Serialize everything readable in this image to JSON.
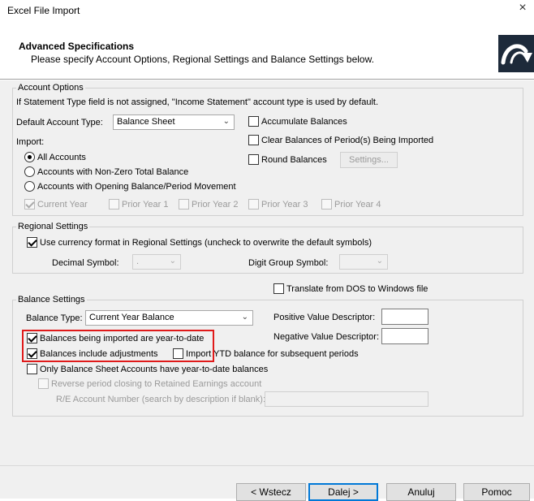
{
  "window": {
    "title": "Excel File Import",
    "close_glyph": "×"
  },
  "header": {
    "title": "Advanced Specifications",
    "subtitle": "Please specify Account Options, Regional Settings and Balance Settings below.",
    "logo_icon": "curved-arrow-logo-icon"
  },
  "account_options": {
    "legend": "Account Options",
    "note": "If Statement Type field is not assigned, \"Income Statement\" account type is used by default.",
    "default_type_label": "Default Account Type:",
    "default_type_value": "Balance Sheet",
    "accumulate_balances": "Accumulate Balances",
    "clear_balances": "Clear Balances of Period(s) Being Imported",
    "round_balances": "Round Balances",
    "settings_button": "Settings...",
    "import_label": "Import:",
    "radio_all": "All Accounts",
    "radio_nonzero": "Accounts with Non-Zero Total Balance",
    "radio_opening": "Accounts with Opening Balance/Period Movement",
    "current_year": "Current Year",
    "prior_year_1": "Prior Year 1",
    "prior_year_2": "Prior Year 2",
    "prior_year_3": "Prior Year 3",
    "prior_year_4": "Prior Year 4"
  },
  "regional": {
    "legend": "Regional Settings",
    "use_currency": "Use currency format in Regional Settings (uncheck to overwrite the default symbols)",
    "decimal_label": "Decimal Symbol:",
    "decimal_value": ".",
    "digit_group_label": "Digit Group Symbol:",
    "digit_group_value": ""
  },
  "balance": {
    "legend": "Balance Settings",
    "translate_dos": "Translate from DOS to Windows file",
    "type_label": "Balance Type:",
    "type_value": "Current Year Balance",
    "positive_label": "Positive Value Descriptor:",
    "negative_label": "Negative Value Descriptor:",
    "ytd": "Balances being imported are year-to-date",
    "adjustments": "Balances include adjustments",
    "import_ytd": "Import YTD balance for subsequent periods",
    "only_bs": "Only Balance Sheet Accounts have year-to-date balances",
    "reverse_closing": "Reverse period closing to Retained Earnings account",
    "re_account": "R/E Account Number (search by description if blank):"
  },
  "footer": {
    "back": "< Wstecz",
    "next": "Dalej >",
    "cancel": "Anuluj",
    "help": "Pomoc"
  }
}
